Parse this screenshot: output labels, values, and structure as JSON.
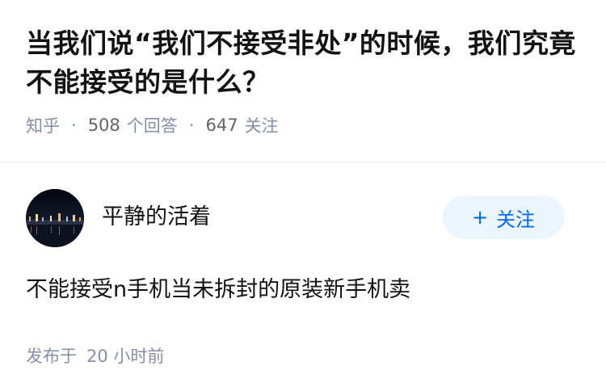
{
  "question": {
    "title": "当我们说“我们不接受非处”的时候，我们究竟不能接受的是什么？",
    "platform": "知乎",
    "answer_count": "508",
    "answer_label": "个回答",
    "follower_count": "647",
    "follower_label": "关注"
  },
  "answer": {
    "author_name": "平静的活着",
    "follow_button": "关注",
    "content": "不能接受n手机当未拆封的原装新手机卖",
    "time_label": "发布于",
    "time_value": "20 小时前"
  }
}
